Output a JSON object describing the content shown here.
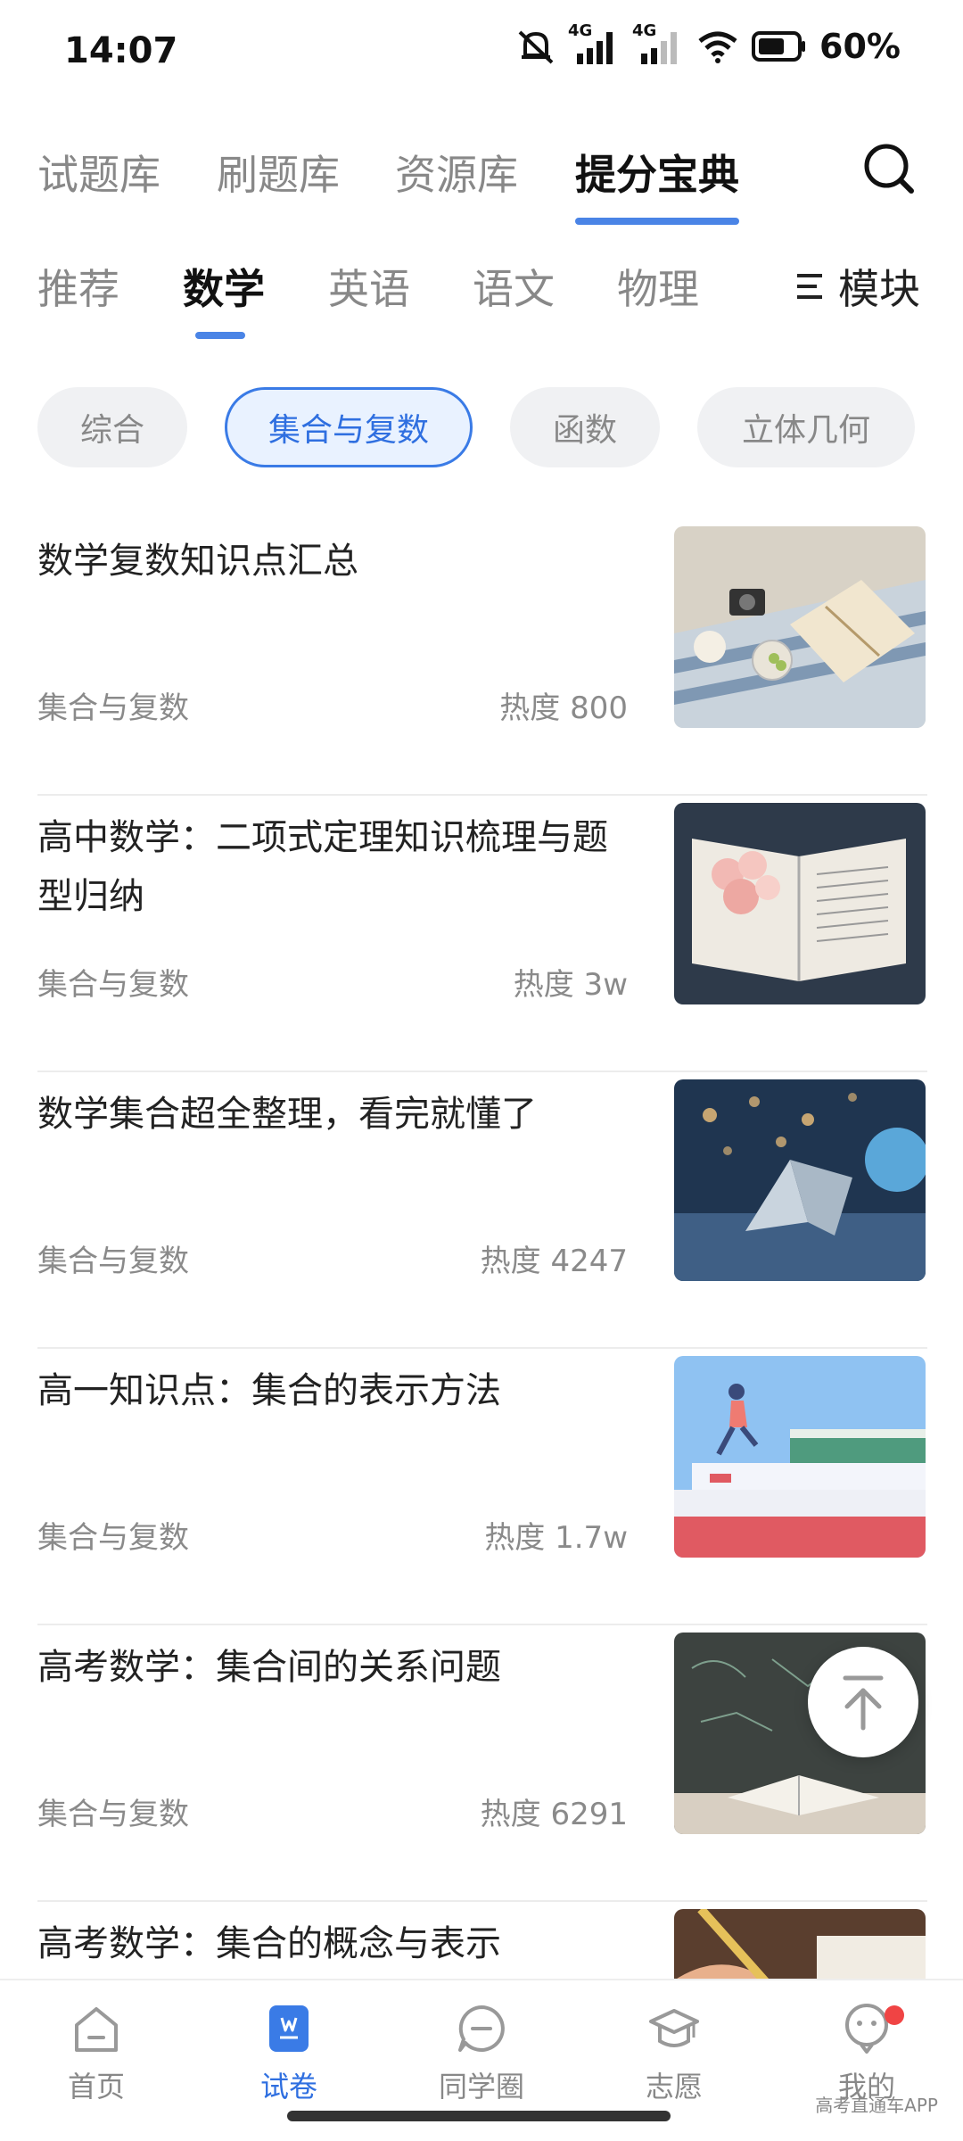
{
  "status_bar": {
    "time": "14:07",
    "network_1": "4G",
    "network_2": "4G",
    "battery": "60%"
  },
  "top_tabs": [
    {
      "label": "试题库"
    },
    {
      "label": "刷题库"
    },
    {
      "label": "资源库"
    },
    {
      "label": "提分宝典",
      "active": true
    }
  ],
  "subject_tabs": [
    {
      "label": "推荐"
    },
    {
      "label": "数学",
      "active": true
    },
    {
      "label": "英语"
    },
    {
      "label": "语文"
    },
    {
      "label": "物理"
    }
  ],
  "module_button": {
    "label": "模块",
    "icon": "menu-icon"
  },
  "chips": [
    {
      "label": "综合"
    },
    {
      "label": "集合与复数",
      "active": true
    },
    {
      "label": "函数"
    },
    {
      "label": "立体几何"
    }
  ],
  "articles": [
    {
      "title": "数学复数知识点汇总",
      "tag": "集合与复数",
      "heat": "热度 800",
      "thumb": "picnic-book-photo"
    },
    {
      "title": "高中数学：二项式定理知识梳理与题型归纳",
      "tag": "集合与复数",
      "heat": "热度 3w",
      "thumb": "open-book-flowers-photo"
    },
    {
      "title": "数学集合超全整理，看完就懂了",
      "tag": "集合与复数",
      "heat": "热度 4247",
      "thumb": "book-bokeh-photo"
    },
    {
      "title": "高一知识点：集合的表示方法",
      "tag": "集合与复数",
      "heat": "热度 1.7w",
      "thumb": "books-runner-illustration"
    },
    {
      "title": "高考数学：集合间的关系问题",
      "tag": "集合与复数",
      "heat": "热度 6291",
      "thumb": "chalkboard-book-photo"
    },
    {
      "title": "高考数学：集合的概念与表示",
      "tag": "",
      "heat": "",
      "thumb": "hand-pencil-photo"
    }
  ],
  "bottom_nav": [
    {
      "label": "首页",
      "icon": "home-icon"
    },
    {
      "label": "试卷",
      "icon": "exam-paper-icon",
      "active": true
    },
    {
      "label": "同学圈",
      "icon": "chat-bubble-icon"
    },
    {
      "label": "志愿",
      "icon": "graduation-cap-icon"
    },
    {
      "label": "我的",
      "icon": "profile-icon",
      "badge": true
    }
  ],
  "watermark": "高考直通车APP",
  "colors": {
    "accent": "#3a7be6",
    "badge": "#f04444"
  }
}
